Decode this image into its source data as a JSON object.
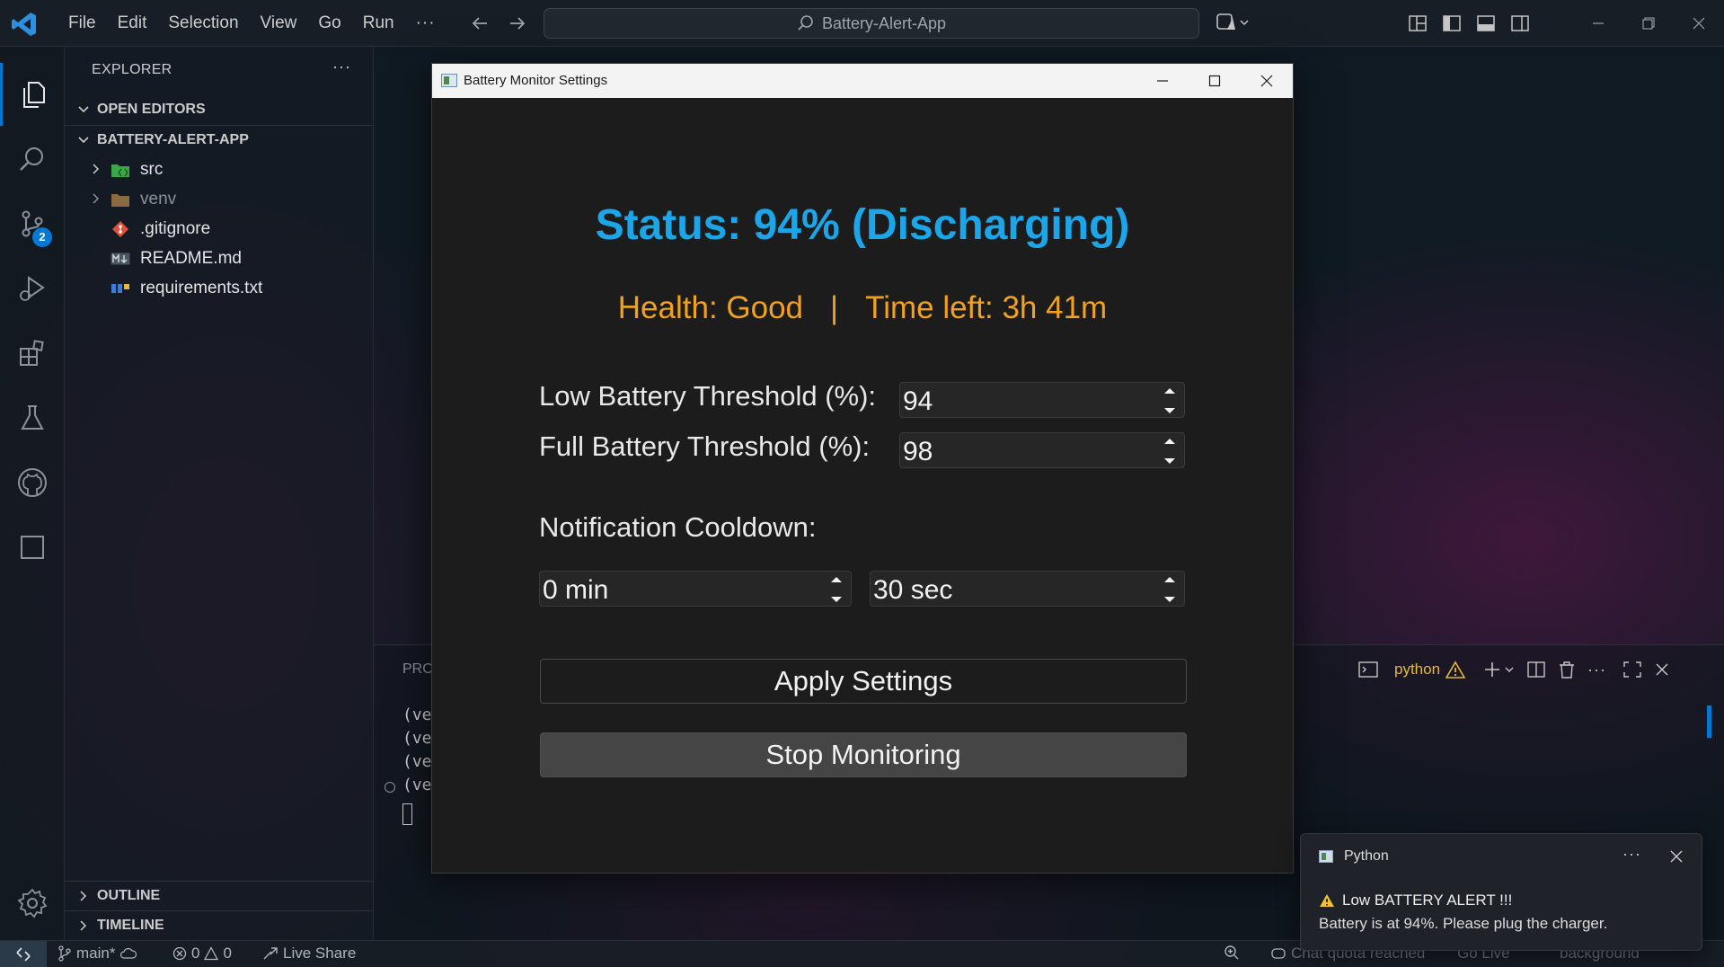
{
  "titlebar": {
    "menu": [
      "File",
      "Edit",
      "Selection",
      "View",
      "Go",
      "Run"
    ],
    "more": "···",
    "search_text": "Battery-Alert-App"
  },
  "activity": {
    "source_control_badge": "2"
  },
  "sidebar": {
    "title": "EXPLORER",
    "more": "···",
    "open_editors": "OPEN EDITORS",
    "project": "BATTERY-ALERT-APP",
    "files": [
      {
        "name": "src",
        "type": "folder",
        "icon": "folder-src-icon"
      },
      {
        "name": "venv",
        "type": "folder",
        "icon": "folder-icon"
      },
      {
        "name": ".gitignore",
        "type": "file",
        "icon": "git-icon"
      },
      {
        "name": "README.md",
        "type": "file",
        "icon": "markdown-icon"
      },
      {
        "name": "requirements.txt",
        "type": "file",
        "icon": "pip-icon"
      }
    ],
    "outline": "OUTLINE",
    "timeline": "TIMELINE"
  },
  "panel": {
    "tab": "PRO",
    "terminal_lines": [
      "(ve",
      "(ve",
      "(ve",
      "(ve"
    ],
    "shell": "python"
  },
  "statusbar": {
    "branch": "main*",
    "errors": "0",
    "warnings": "0",
    "live_share": "Live Share",
    "chat": "Chat quota reached",
    "go_live": "Go Live",
    "background": "background"
  },
  "battery_window": {
    "title": "Battery Monitor Settings",
    "status": "Status: 94% (Discharging)",
    "health": "Health: Good",
    "separator": "|",
    "time_left": "Time left: 3h 41m",
    "low_label": "Low Battery Threshold (%):",
    "low_value": "94",
    "full_label": "Full Battery Threshold (%):",
    "full_value": "98",
    "cooldown_label": "Notification Cooldown:",
    "cooldown_min": "0 min",
    "cooldown_sec": "30 sec",
    "apply_button": "Apply Settings",
    "stop_button": "Stop Monitoring",
    "status_color": "#1aa6e8",
    "info_color": "#f0a21e"
  },
  "notification": {
    "source": "Python",
    "more": "···",
    "title": "Low BATTERY ALERT !!!",
    "message": "Battery is at 94%. Please plug the charger."
  }
}
